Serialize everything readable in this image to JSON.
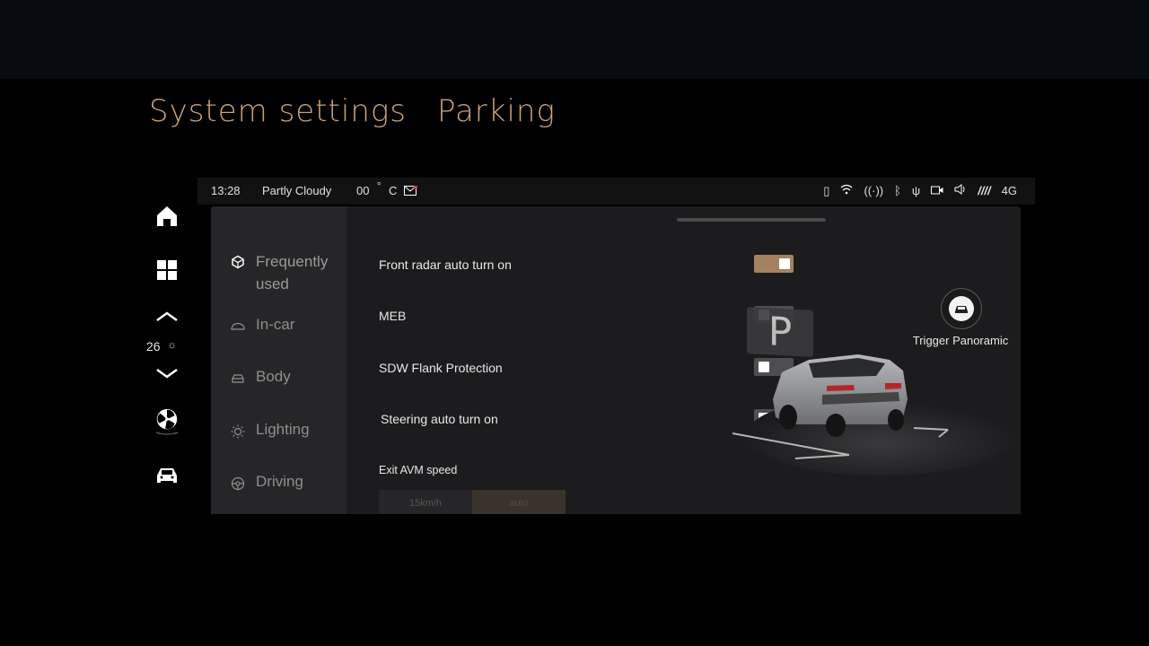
{
  "heading": {
    "part1": "System settings",
    "part2": "Parking"
  },
  "rail": {
    "temperature": "26"
  },
  "status_bar": {
    "time": "13:28",
    "weather": "Partly Cloudy",
    "temp": "00",
    "degree": "°",
    "unit": "C",
    "network": "4G"
  },
  "nav": {
    "items": [
      {
        "label": "Frequently used",
        "icon": "cube-icon",
        "active": true
      },
      {
        "label": "In-car",
        "icon": "car-outline-icon"
      },
      {
        "label": "Body",
        "icon": "car-body-icon"
      },
      {
        "label": "Lighting",
        "icon": "sun-icon"
      },
      {
        "label": "Driving",
        "icon": "steering-wheel-icon"
      }
    ]
  },
  "settings": [
    {
      "label": "Front radar auto turn on",
      "on": true
    },
    {
      "label": "MEB",
      "on": false
    },
    {
      "label": "SDW Flank Protection",
      "on": false
    },
    {
      "label": "Steering auto turn on",
      "on": false
    }
  ],
  "avm": {
    "label": "Exit AVM speed",
    "options": [
      "15km/h",
      "auto"
    ]
  },
  "gear": "P",
  "trigger": {
    "label": "Trigger Panoramic"
  },
  "colors": {
    "accent": "#a5825f",
    "heading": "#c9a27a",
    "panel": "#1c1c1e"
  }
}
